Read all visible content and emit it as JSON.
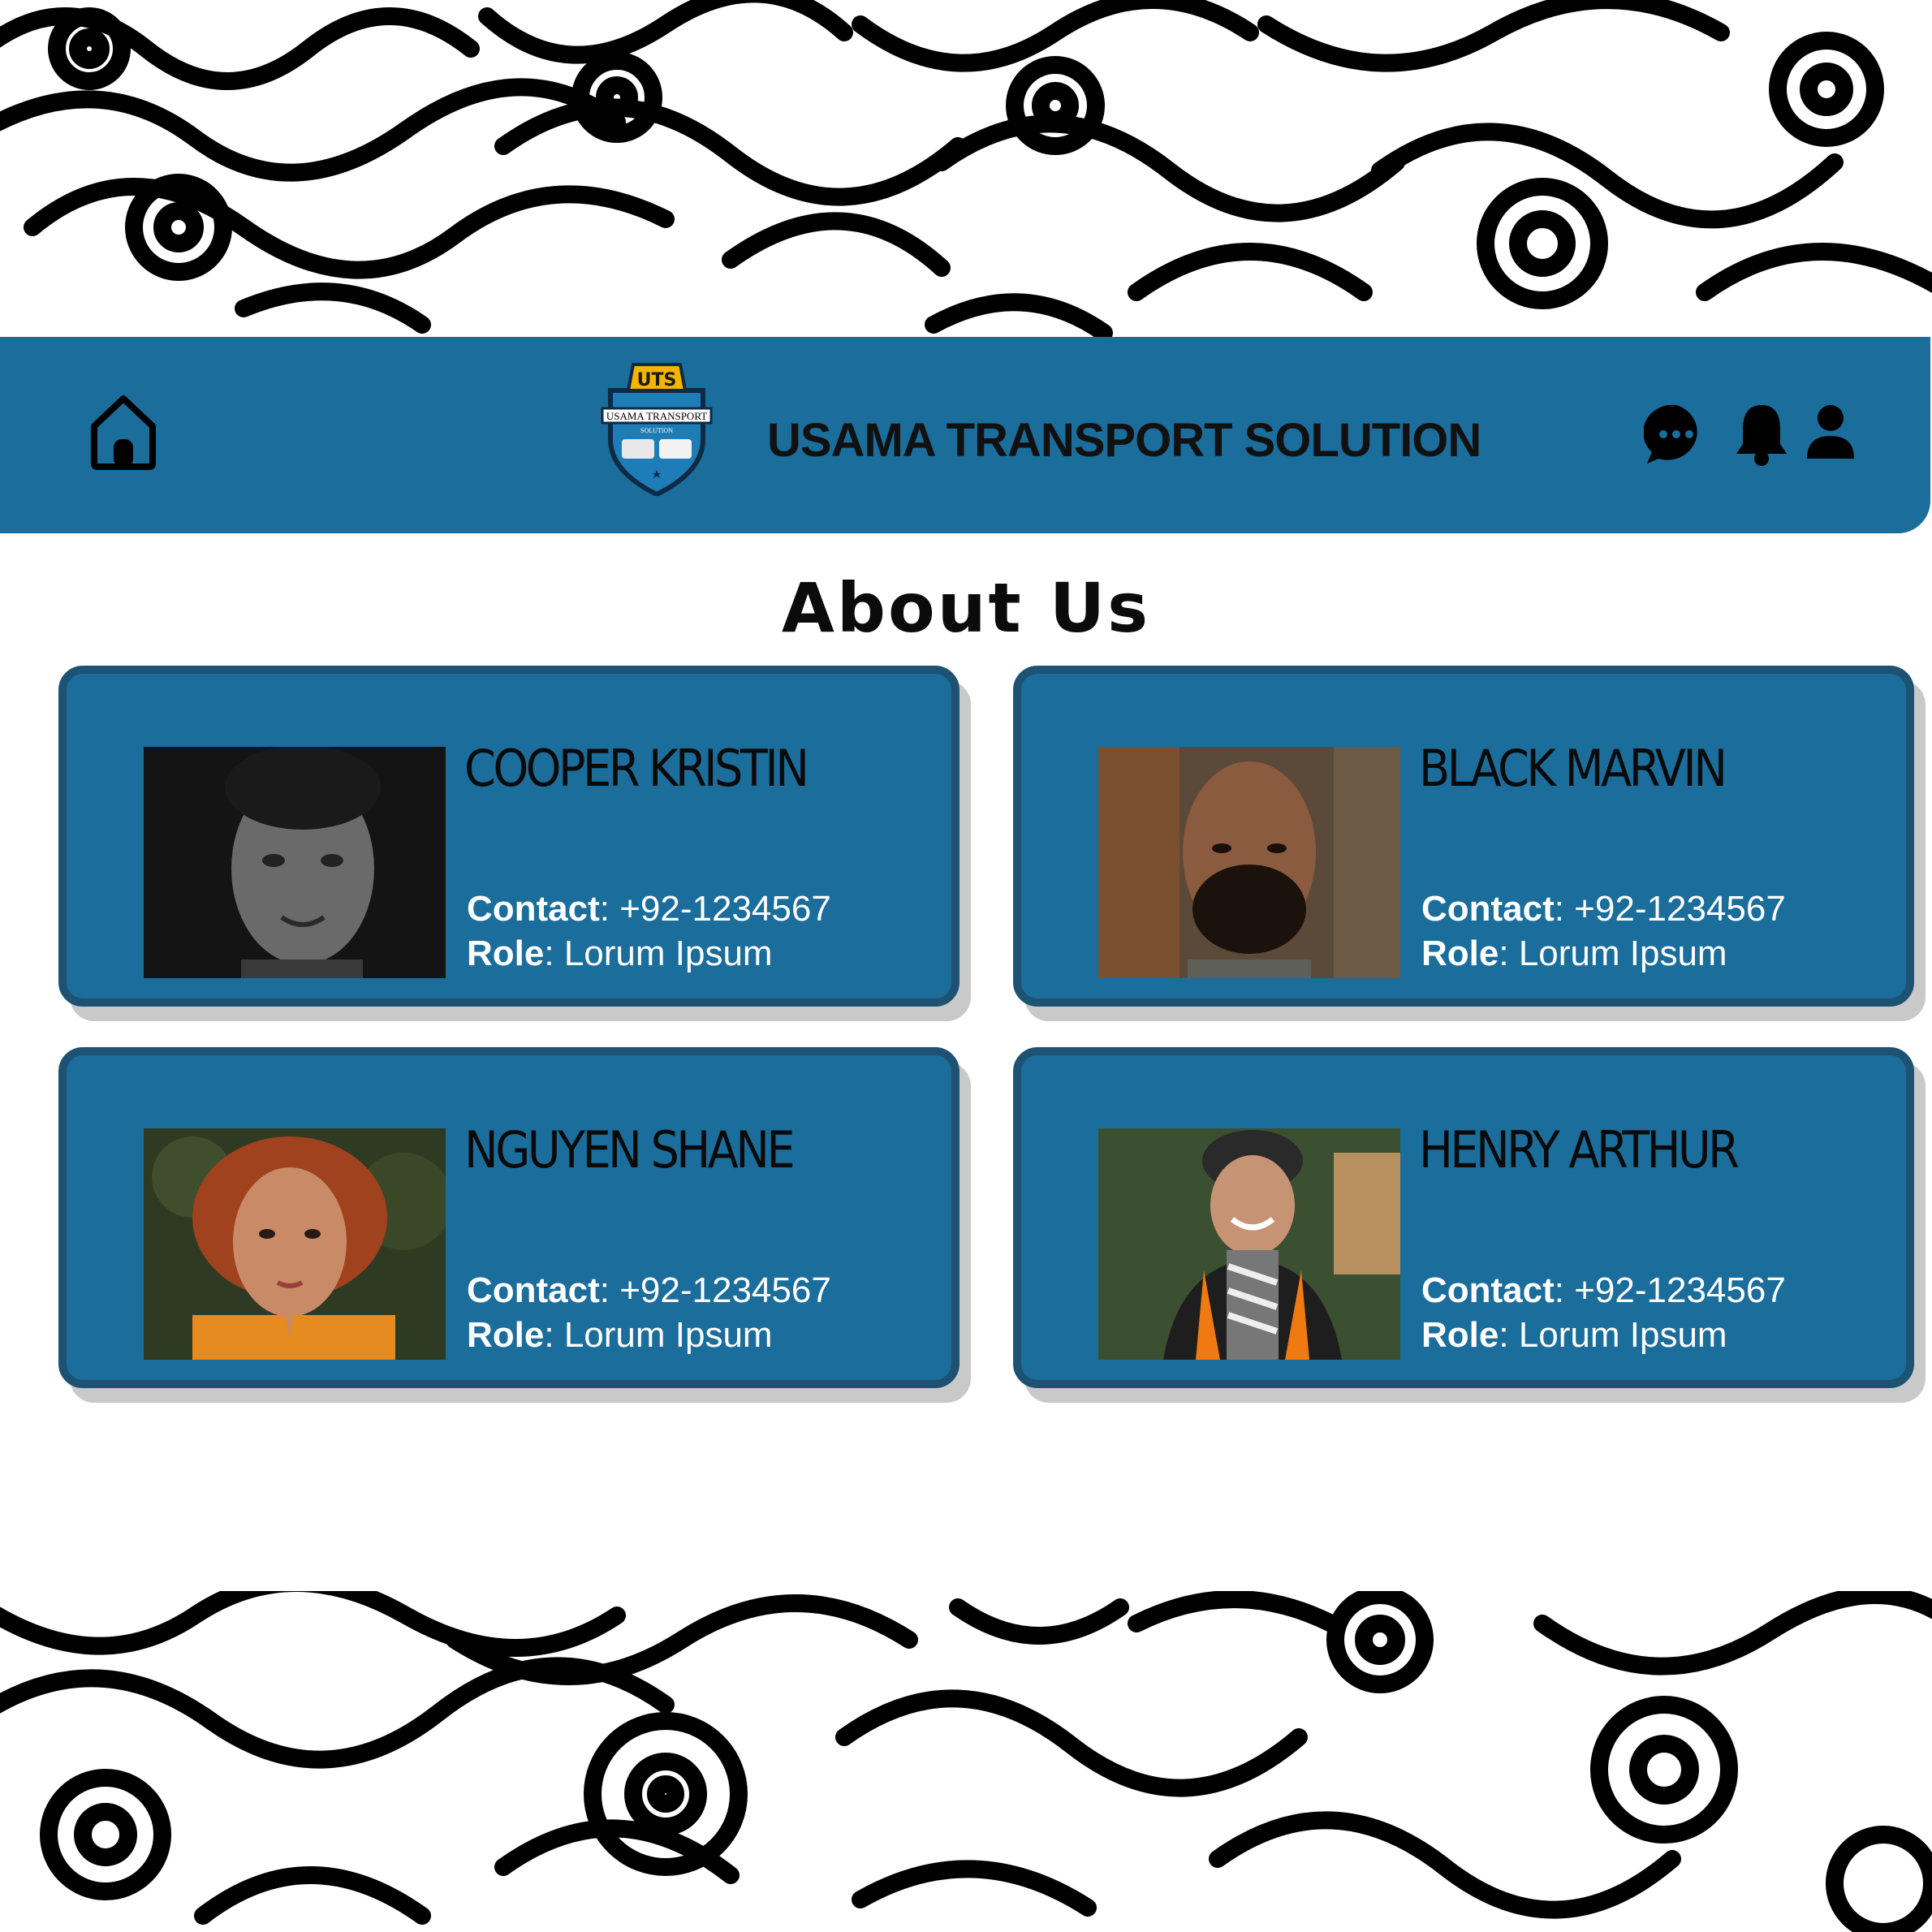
{
  "header": {
    "title": "USAMA TRANSPORT SOLUTION",
    "logo": {
      "initials": "UTS",
      "ribbon": "USAMA TRANSPORT",
      "sub": "SOLUTION"
    },
    "icons": [
      "home-icon",
      "chat-icon",
      "bell-icon",
      "user-icon"
    ]
  },
  "page": {
    "heading": "About Us"
  },
  "team": [
    {
      "name": "COOPER KRISTIN",
      "contact_label": "Contact",
      "contact": "+92-1234567",
      "role_label": "Role",
      "role": "Lorum Ipsum"
    },
    {
      "name": "BLACK MARVIN",
      "contact_label": "Contact",
      "contact": "+92-1234567",
      "role_label": "Role",
      "role": "Lorum Ipsum"
    },
    {
      "name": "NGUYEN SHANE",
      "contact_label": "Contact",
      "contact": "+92-1234567",
      "role_label": "Role",
      "role": "Lorum Ipsum"
    },
    {
      "name": "HENRY ARTHUR",
      "contact_label": "Contact",
      "contact": "+92-1234567",
      "role_label": "Role",
      "role": "Lorum Ipsum"
    }
  ],
  "colors": {
    "header_bg": "#1b6d9b",
    "card_bg": "#1b6d9b",
    "card_border": "#1d5273",
    "text_dark": "#111111",
    "text_light": "#ffffff"
  }
}
